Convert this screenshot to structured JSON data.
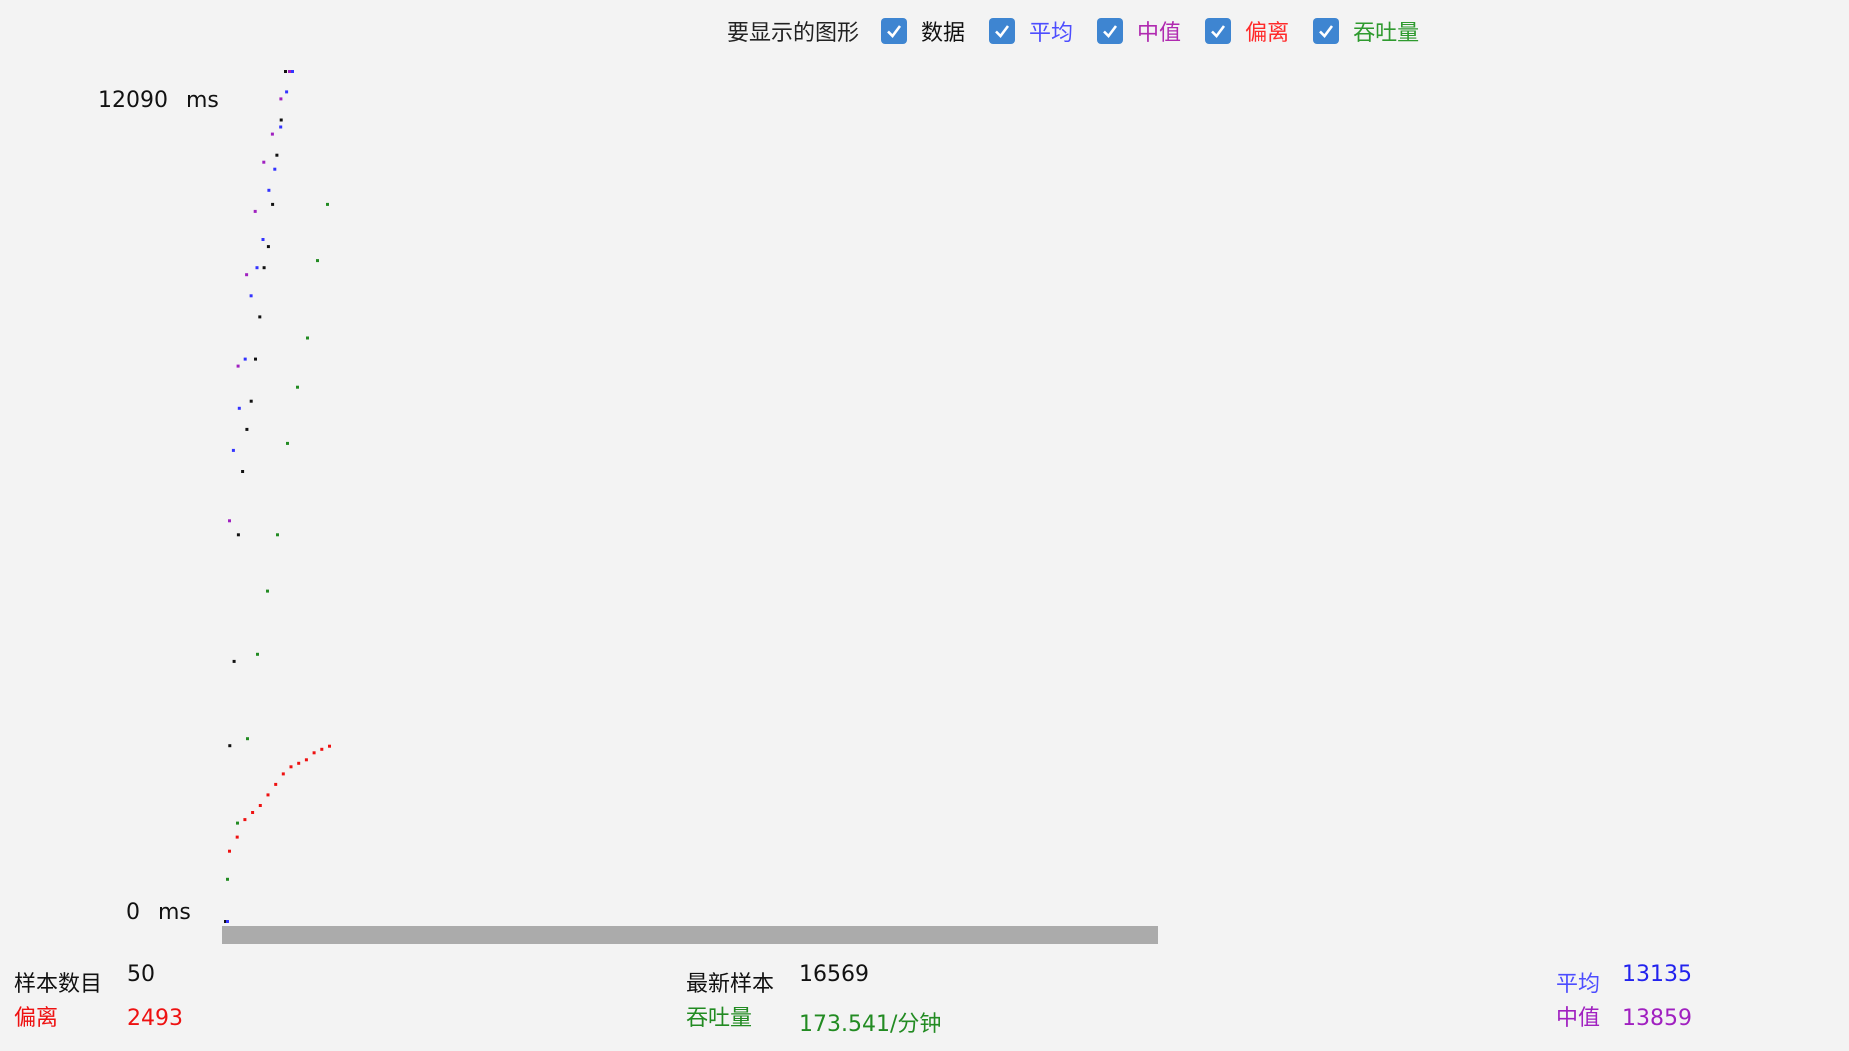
{
  "legend": {
    "title": "要显示的图形",
    "items": [
      {
        "label": "数据",
        "color": "#111111",
        "checked": true
      },
      {
        "label": "平均",
        "color": "#4d4dff",
        "checked": true
      },
      {
        "label": "中值",
        "color": "#b02ab0",
        "checked": true
      },
      {
        "label": "偏离",
        "color": "#ff2a2a",
        "checked": true
      },
      {
        "label": "吞吐量",
        "color": "#2e9a2e",
        "checked": true
      }
    ]
  },
  "y_axis": {
    "max_value": "12090",
    "min_value": "0",
    "unit": "ms"
  },
  "stats": {
    "samples": {
      "label": "样本数目",
      "value": "50"
    },
    "deviation": {
      "label": "偏离",
      "value": "2493"
    },
    "latest": {
      "label": "最新样本",
      "value": "16569"
    },
    "throughput": {
      "label": "吞吐量",
      "value": "173.541/分钟"
    },
    "average": {
      "label": "平均",
      "value": "13135"
    },
    "median": {
      "label": "中值",
      "value": "13859"
    }
  },
  "colors": {
    "data": "#111111",
    "average": "#3333ff",
    "median": "#a020c0",
    "deviation": "#ee1111",
    "throughput": "#228b22",
    "checkbox": "#3e85d1"
  },
  "chart_data": {
    "type": "scatter",
    "y_range": [
      0,
      12090
    ],
    "y_unit": "ms",
    "series": [
      {
        "name": "数据",
        "values": [
          0,
          2500,
          3700,
          5500,
          6400,
          7000,
          7400,
          8000,
          8600,
          9300,
          9600,
          10200,
          10900,
          11400,
          12090
        ]
      },
      {
        "name": "平均",
        "values": [
          0,
          6700,
          7300,
          8000,
          8900,
          9300,
          9700,
          10400,
          10700,
          11300,
          11800,
          12090
        ]
      },
      {
        "name": "中值",
        "values": [
          5700,
          7900,
          9200,
          10100,
          10800,
          11200,
          11700,
          12090
        ]
      },
      {
        "name": "偏离",
        "values": [
          1000,
          1200,
          1450,
          1550,
          1650,
          1800,
          1950,
          2100,
          2200,
          2250,
          2300,
          2400,
          2450,
          2493
        ]
      },
      {
        "name": "吞吐量",
        "values": [
          600,
          1400,
          2600,
          3800,
          4700,
          5500,
          6800,
          7600,
          8300,
          9400,
          10200
        ]
      }
    ]
  }
}
